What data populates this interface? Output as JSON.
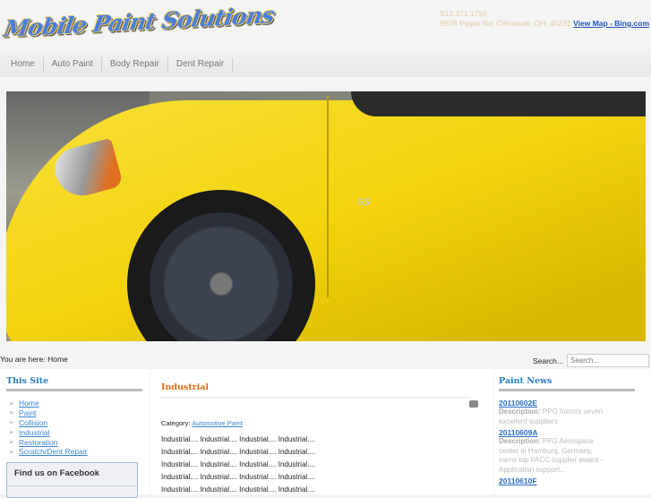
{
  "header": {
    "logo_text": "Mobile Paint Solutions",
    "phone": "513.371.1750",
    "address": "9978 Pippin Rd, Cincinnati, OH, 45231",
    "map_link": "View Map - Bing.com"
  },
  "nav": [
    "Home",
    "Auto Paint",
    "Body Repair",
    "Dent Repair"
  ],
  "hero": {
    "badge": "SS"
  },
  "breadcrumb": {
    "label": "You are here:",
    "current": "Home"
  },
  "search": {
    "label": "Search...",
    "placeholder": "Search..."
  },
  "left": {
    "title": "This Site",
    "links": [
      "Home",
      "Paint",
      "Collision",
      "Industrial",
      "Restoration",
      "Scratch/Dent Repair"
    ],
    "facebook_title": "Find us on Facebook"
  },
  "main": {
    "title": "Industrial",
    "category_label": "Category:",
    "category": "Automotive Paint",
    "rows": [
      "Industrial.... Industrial.... Industrial.... Industrial....",
      "Industrial.... Industrial.... Industrial.... Industrial....",
      "Industrial.... Industrial.... Industrial.... Industrial....",
      "Industrial.... Industrial.... Industrial.... Industrial....",
      "Industrial.... Industrial.... Industrial.... Industrial...."
    ]
  },
  "right": {
    "title": "Paint News",
    "items": [
      {
        "id": "20110602E",
        "label": "Description:",
        "text": "PPG honors seven excellent suppliers"
      },
      {
        "id": "20110609A",
        "label": "Description:",
        "text": "PPG Aerospace center in Hamburg, Germany, earns top FACC supplier award – Application support..."
      },
      {
        "id": "20110610F",
        "label": "",
        "text": ""
      }
    ]
  }
}
